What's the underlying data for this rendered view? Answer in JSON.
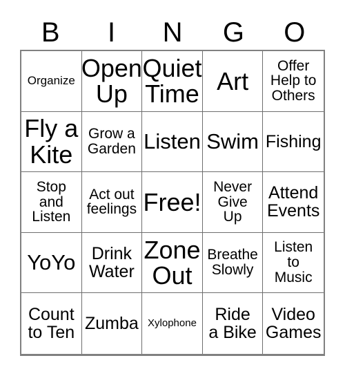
{
  "card": {
    "headers": [
      "B",
      "I",
      "N",
      "G",
      "O"
    ],
    "rows": [
      [
        {
          "text": "Organize",
          "size": "fs-sm"
        },
        {
          "text": "Open\nUp",
          "size": "fs-xxl"
        },
        {
          "text": "Quiet\nTime",
          "size": "fs-xxl"
        },
        {
          "text": "Art",
          "size": "fs-xxl"
        },
        {
          "text": "Offer\nHelp to\nOthers",
          "size": "fs-md"
        }
      ],
      [
        {
          "text": "Fly a\nKite",
          "size": "fs-xxl"
        },
        {
          "text": "Grow a\nGarden",
          "size": "fs-md"
        },
        {
          "text": "Listen",
          "size": "fs-xl"
        },
        {
          "text": "Swim",
          "size": "fs-xl"
        },
        {
          "text": "Fishing",
          "size": "fs-lg"
        }
      ],
      [
        {
          "text": "Stop\nand\nListen",
          "size": "fs-md"
        },
        {
          "text": "Act out\nfeelings",
          "size": "fs-md"
        },
        {
          "text": "Free!",
          "size": "fs-xxl"
        },
        {
          "text": "Never\nGive\nUp",
          "size": "fs-md"
        },
        {
          "text": "Attend\nEvents",
          "size": "fs-lg"
        }
      ],
      [
        {
          "text": "YoYo",
          "size": "fs-xl"
        },
        {
          "text": "Drink\nWater",
          "size": "fs-lg"
        },
        {
          "text": "Zone\nOut",
          "size": "fs-xxl"
        },
        {
          "text": "Breathe\nSlowly",
          "size": "fs-md"
        },
        {
          "text": "Listen\nto\nMusic",
          "size": "fs-md"
        }
      ],
      [
        {
          "text": "Count\nto Ten",
          "size": "fs-lg"
        },
        {
          "text": "Zumba",
          "size": "fs-lg"
        },
        {
          "text": "Xylophone",
          "size": "fs-xs"
        },
        {
          "text": "Ride\na Bike",
          "size": "fs-lg"
        },
        {
          "text": "Video\nGames",
          "size": "fs-lg"
        }
      ]
    ]
  },
  "colors": {
    "background": "#ffffff",
    "text": "#000000",
    "grid_border": "#808080",
    "cell_border": "#6e6e6e"
  }
}
